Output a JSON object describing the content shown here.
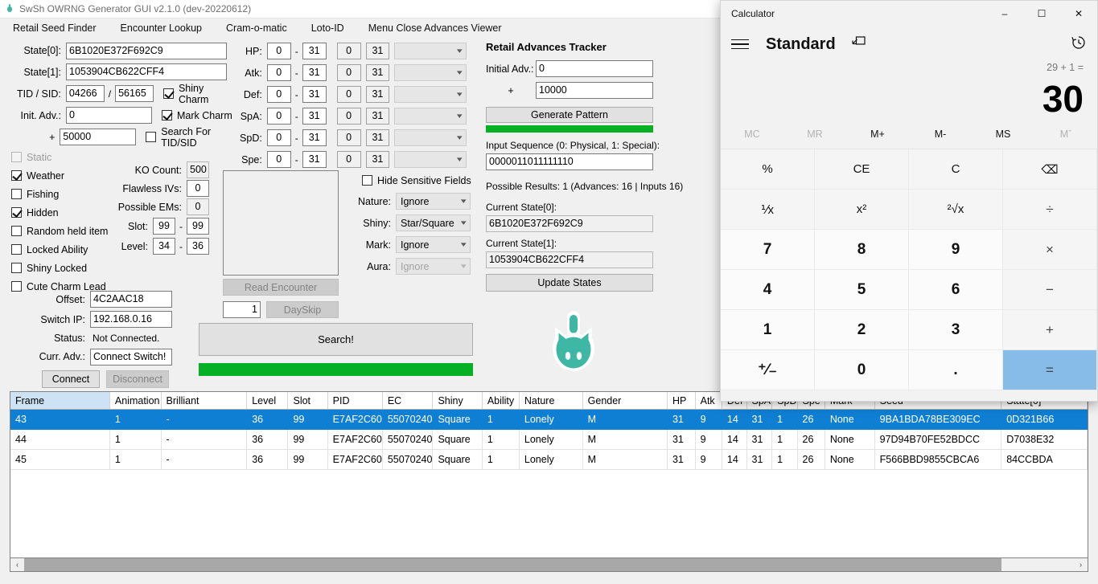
{
  "window": {
    "title": "SwSh OWRNG Generator GUI v2.1.0 (dev-20220612)",
    "icon": "pokeball-icon"
  },
  "menubar": {
    "items": [
      {
        "label": "Retail Seed Finder"
      },
      {
        "label": "Encounter Lookup"
      },
      {
        "label": "Cram-o-matic"
      },
      {
        "label": "Loto-ID"
      },
      {
        "label": "Menu Close Advances Viewer"
      }
    ]
  },
  "seed_panel": {
    "state0_label": "State[0]:",
    "state0_value": "6B1020E372F692C9",
    "state1_label": "State[1]:",
    "state1_value": "1053904CB622CFF4",
    "tidsid_label": "TID / SID:",
    "tid_value": "04266",
    "tidsid_sep": "/",
    "sid_value": "56165",
    "init_adv_label": "Init. Adv.:",
    "init_adv_value": "0",
    "plus_label": "+",
    "plus_value": "50000",
    "shiny_charm": "Shiny Charm",
    "mark_charm": "Mark Charm",
    "search_tidsid": "Search For TID/SID"
  },
  "flags": {
    "static": "Static",
    "weather": "Weather",
    "fishing": "Fishing",
    "hidden": "Hidden",
    "random_held_item": "Random held item",
    "locked_ability": "Locked Ability",
    "shiny_locked": "Shiny Locked",
    "cute_charm_lead": "Cute Charm Lead"
  },
  "counts": {
    "ko_count_label": "KO Count:",
    "ko_count_value": "500",
    "flawless_label": "Flawless IVs:",
    "flawless_value": "0",
    "ems_label": "Possible EMs:",
    "ems_value": "0",
    "slot_label": "Slot:",
    "slot_min": "99",
    "slot_sep": "-",
    "slot_max": "99",
    "level_label": "Level:",
    "level_min": "34",
    "level_sep": "-",
    "level_max": "36"
  },
  "connection": {
    "offset_label": "Offset:",
    "offset_value": "4C2AAC18",
    "switch_ip_label": "Switch IP:",
    "switch_ip_value": "192.168.0.16",
    "status_label": "Status:",
    "status_value": "Not Connected.",
    "curr_adv_label": "Curr. Adv.:",
    "curr_adv_value": "Connect Switch!",
    "connect_button": "Connect",
    "disconnect_button": "Disconnect"
  },
  "ivs": {
    "rows": [
      {
        "label": "HP:",
        "min": "0",
        "max": "31",
        "min2": "0",
        "max2": "31",
        "combo": ""
      },
      {
        "label": "Atk:",
        "min": "0",
        "max": "31",
        "min2": "0",
        "max2": "31",
        "combo": ""
      },
      {
        "label": "Def:",
        "min": "0",
        "max": "31",
        "min2": "0",
        "max2": "31",
        "combo": ""
      },
      {
        "label": "SpA:",
        "min": "0",
        "max": "31",
        "min2": "0",
        "max2": "31",
        "combo": ""
      },
      {
        "label": "SpD:",
        "min": "0",
        "max": "31",
        "min2": "0",
        "max2": "31",
        "combo": ""
      },
      {
        "label": "Spe:",
        "min": "0",
        "max": "31",
        "min2": "0",
        "max2": "31",
        "combo": ""
      }
    ]
  },
  "filters": {
    "hide_sensitive": "Hide Sensitive Fields",
    "nature_label": "Nature:",
    "nature_value": "Ignore",
    "shiny_label": "Shiny:",
    "shiny_value": "Star/Square",
    "mark_label": "Mark:",
    "mark_value": "Ignore",
    "aura_label": "Aura:",
    "aura_value": "Ignore"
  },
  "actions": {
    "read_encounter": "Read Encounter",
    "dayskip_count": "1",
    "dayskip": "DaySkip",
    "search": "Search!"
  },
  "tracker": {
    "title": "Retail Advances Tracker",
    "initial_adv_label": "Initial Adv.:",
    "initial_adv_value": "0",
    "plus_label": "+",
    "plus_value": "10000",
    "generate_pattern": "Generate Pattern",
    "input_sequence_label": "Input Sequence (0: Physical, 1: Special):",
    "input_sequence_value": "0000011011111110",
    "possible_results": "Possible Results: 1 (Advances: 16 | Inputs 16)",
    "current_state0_label": "Current State[0]:",
    "current_state0_value": "6B1020E372F692C9",
    "current_state1_label": "Current State[1]:",
    "current_state1_value": "1053904CB622CFF4",
    "update_states": "Update States"
  },
  "table": {
    "headers": [
      "Frame",
      "Animation",
      "Brilliant",
      "Level",
      "Slot",
      "PID",
      "EC",
      "Shiny",
      "Ability",
      "Nature",
      "Gender",
      "HP",
      "Atk",
      "Def",
      "SpA",
      "SpD",
      "Spe",
      "Mark",
      "Seed",
      "State[0]"
    ],
    "selected_header": "Frame",
    "rows": [
      {
        "selected": true,
        "cells": [
          "43",
          "1",
          "-",
          "36",
          "99",
          "E7AF2C60",
          "55070240",
          "Square",
          "1",
          "Lonely",
          "M",
          "31",
          "9",
          "14",
          "31",
          "1",
          "26",
          "None",
          "9BA1BDA78BE309EC",
          "0D321B66"
        ]
      },
      {
        "selected": false,
        "cells": [
          "44",
          "1",
          "-",
          "36",
          "99",
          "E7AF2C60",
          "55070240",
          "Square",
          "1",
          "Lonely",
          "M",
          "31",
          "9",
          "14",
          "31",
          "1",
          "26",
          "None",
          "97D94B70FE52BDCC",
          "D7038E32"
        ]
      },
      {
        "selected": false,
        "cells": [
          "45",
          "1",
          "-",
          "36",
          "99",
          "E7AF2C60",
          "55070240",
          "Square",
          "1",
          "Lonely",
          "M",
          "31",
          "9",
          "14",
          "31",
          "1",
          "26",
          "None",
          "F566BBD9855CBCA6",
          "84CCBDA"
        ]
      }
    ],
    "scroll_left_arrow": "‹",
    "scroll_right_arrow": "›"
  },
  "calculator": {
    "title": "Calculator",
    "minimize": "–",
    "maximize": "☐",
    "close": "✕",
    "mode": "Standard",
    "keep_on_top_icon": "keep-on-top-icon",
    "history_icon": "history-icon",
    "expression": "29 + 1 =",
    "result": "30",
    "memory": [
      {
        "label": "MC",
        "disabled": true
      },
      {
        "label": "MR",
        "disabled": true
      },
      {
        "label": "M+",
        "disabled": false
      },
      {
        "label": "M-",
        "disabled": false
      },
      {
        "label": "MS",
        "disabled": false
      },
      {
        "label": "Mˇ",
        "disabled": true
      }
    ],
    "keys": [
      {
        "label": "%",
        "type": "fn",
        "name": "percent"
      },
      {
        "label": "CE",
        "type": "fn",
        "name": "clear-entry"
      },
      {
        "label": "C",
        "type": "fn",
        "name": "clear"
      },
      {
        "label": "⌫",
        "type": "fn",
        "name": "backspace"
      },
      {
        "label": "⅟x",
        "type": "fn",
        "name": "reciprocal"
      },
      {
        "label": "x²",
        "type": "fn",
        "name": "square"
      },
      {
        "label": "²√x",
        "type": "fn",
        "name": "square-root"
      },
      {
        "label": "÷",
        "type": "op",
        "name": "divide"
      },
      {
        "label": "7",
        "type": "num",
        "name": "seven"
      },
      {
        "label": "8",
        "type": "num",
        "name": "eight"
      },
      {
        "label": "9",
        "type": "num",
        "name": "nine"
      },
      {
        "label": "×",
        "type": "op",
        "name": "multiply"
      },
      {
        "label": "4",
        "type": "num",
        "name": "four"
      },
      {
        "label": "5",
        "type": "num",
        "name": "five"
      },
      {
        "label": "6",
        "type": "num",
        "name": "six"
      },
      {
        "label": "−",
        "type": "op",
        "name": "subtract"
      },
      {
        "label": "1",
        "type": "num",
        "name": "one"
      },
      {
        "label": "2",
        "type": "num",
        "name": "two"
      },
      {
        "label": "3",
        "type": "num",
        "name": "three"
      },
      {
        "label": "+",
        "type": "op",
        "name": "add"
      },
      {
        "label": "⁺⁄₋",
        "type": "fn",
        "name": "negate"
      },
      {
        "label": "0",
        "type": "num",
        "name": "zero"
      },
      {
        "label": ".",
        "type": "num",
        "name": "decimal"
      },
      {
        "label": "=",
        "type": "eq",
        "name": "equals"
      }
    ]
  },
  "colors": {
    "progress_green": "#06b025",
    "selection_blue": "#0f7fd4",
    "header_selected": "#cde3f5",
    "equals_blue": "#88bce8",
    "mascot_teal": "#3fb7a5"
  }
}
